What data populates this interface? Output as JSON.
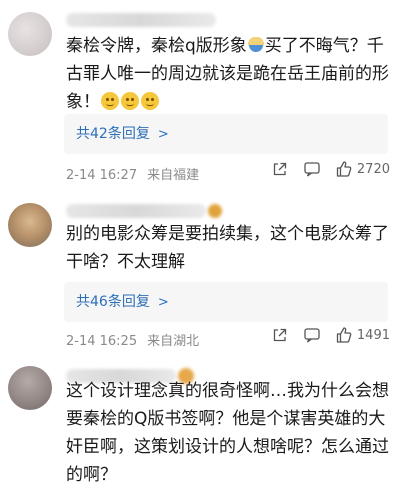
{
  "comments": [
    {
      "text_pre": "秦桧令牌，秦桧q版形象",
      "text_post": "买了不晦气？千古罪人唯一的周边就该是跪在岳王庙前的形象！",
      "replies_label": "共42条回复",
      "time": "2-14 16:27",
      "location": "来自福建",
      "likes": "2720"
    },
    {
      "text": "别的电影众筹是要拍续集，这个电影众筹了干啥？不太理解",
      "replies_label": "共46条回复",
      "time": "2-14 16:25",
      "location": "来自湖北",
      "likes": "1491"
    },
    {
      "text": "这个设计理念真的很奇怪啊…我为什么会想要秦桧的Q版书签啊？他是个谋害英雄的大奸臣啊，这策划设计的人想啥呢？怎么通过的啊？"
    }
  ],
  "icons": [
    "bowl-emoji-icon",
    "smile-emoji-icon",
    "chevron-right-icon",
    "share-icon",
    "comment-icon",
    "like-icon"
  ],
  "colors": {
    "link": "#2e6fb8",
    "meta": "#8a8a8a",
    "reply_bg": "#f6f6f6"
  }
}
